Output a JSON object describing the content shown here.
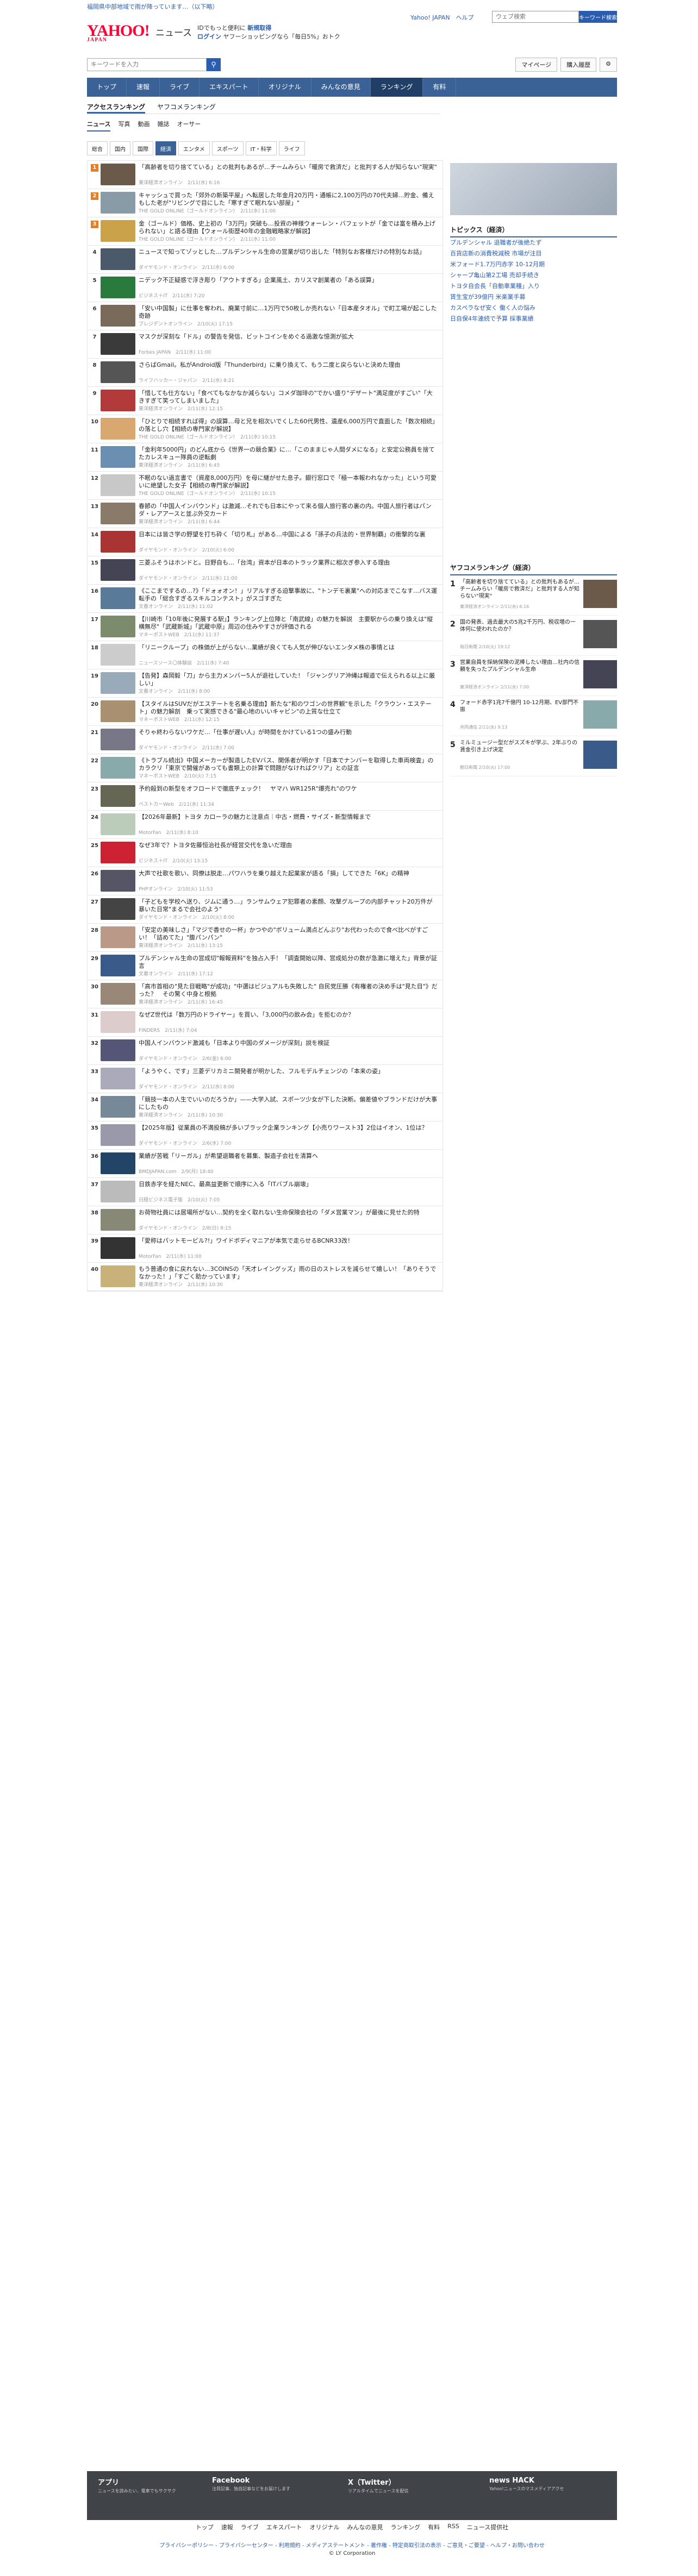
{
  "alert": "福岡県中部地域で雨が降っています…（以下略）",
  "header": {
    "logo": "YAHOO!",
    "logo_sub": "JAPAN",
    "service": "ニュース",
    "promo1": "IDでもっと便利に",
    "promo1_link": "新規取得",
    "promo2_login": "ログイン",
    "promo2": "ヤフーショッピングなら「毎日5%」おトク",
    "links": "Yahoo! JAPAN　ヘルプ",
    "search_placeholder": "ウェブ検索",
    "search_btn": "キーワード検索"
  },
  "search": {
    "placeholder": "キーワードを入力",
    "mypage": "マイページ",
    "purchase": "購入履歴"
  },
  "nav": [
    "トップ",
    "速報",
    "ライブ",
    "エキスパート",
    "オリジナル",
    "みんなの意見",
    "ランキング",
    "有料"
  ],
  "tabs1": [
    "アクセスランキング",
    "ヤフコメランキング"
  ],
  "tabs2": [
    "ニュース",
    "写真",
    "動画",
    "雑誌",
    "オーサー"
  ],
  "tabs3": [
    "総合",
    "国内",
    "国際",
    "経済",
    "エンタメ",
    "スポーツ",
    "IT・科学",
    "ライフ"
  ],
  "items": [
    {
      "rank": "1",
      "title": "「高齢者を切り捨てている」との批判もあるが…チームみらい「暖房で救済だ」と批判する人が知らない\"現実\"",
      "src": "東洋経済オンライン　2/11(水) 6:16"
    },
    {
      "rank": "2",
      "title": "キャッシュで買った「郊外の新築平屋」へ転居した年金月20万円・通帳に2,100万円の70代夫婦…貯金、備えもした老が\"リビングで目にした「寒すぎて眠れない部屋」\"",
      "src": "THE GOLD ONLINE（ゴールドオンライン）　2/11(水) 11:00"
    },
    {
      "rank": "3",
      "title": "金（ゴールド）価格、史上初の「3万円」突破も…投資の神様ウォーレン・バフェットが「金では富を積み上げられない」と語る理由【ウォール街歴40年の金融戦略家が解説】",
      "src": "THE GOLD ONLINE（ゴールドオンライン）　2/11(水) 11:00"
    },
    {
      "rank": "4",
      "title": "ニュースで知ってゾッとした…プルデンシャル生命の営業が切り出した「特別なお客様だけの特別なお話」",
      "src": "ダイヤモンド・オンライン　2/11(水) 6:00"
    },
    {
      "rank": "5",
      "title": "ニデック不正疑惑で浮き彫り「アウトすぎる」企業風土、カリスマ創業者の「ある誤算」",
      "src": "ビジネス＋IT　2/11(水) 7:20"
    },
    {
      "rank": "6",
      "title": "「安い中国製」に仕事を奪われ、廃業寸前に…1万円で50枚しか売れない「日本産タオル」で町工場が起こした奇跡",
      "src": "プレジデントオンライン　2/10(火) 17:15"
    },
    {
      "rank": "7",
      "title": "マスクが深刻な「ドル」の警告を発信、ビットコインをめぐる過激な憶測が拡大",
      "src": "Forbes JAPAN　2/11(水) 11:00"
    },
    {
      "rank": "8",
      "title": "さらばGmail。私がAndroid版「Thunderbird」に乗り換えて、もう二度と戻らないと決めた理由",
      "src": "ライフハッカー・ジャパン　2/11(水) 8:21"
    },
    {
      "rank": "9",
      "title": "「惜しても仕方ない」「食べてもなかなか減らない」コメダ珈琲の\"でかい盛り\"デザート\"満足度がすごい\"「大きすぎて笑ってしまいました」",
      "src": "東洋経済オンライン　2/11(水) 12:15"
    },
    {
      "rank": "10",
      "title": "「ひとりで相続すれば得」の誤算…母と兄を相次いでくした60代男性、遺産6,000万円で直面した「数次相続」の落とし穴【相続の専門家が解説】",
      "src": "THE GOLD ONLINE（ゴールドオンライン）　2/11(水) 10:15"
    },
    {
      "rank": "11",
      "title": "「金利年5000円」のどん底から《世界一の競合業》に…「このままじゃ人間ダメになる」と安定公務員を捨てたカレスキュー隊員の逆転劇",
      "src": "東洋経済オンライン　2/11(水) 6:45"
    },
    {
      "rank": "12",
      "title": "不眠のない過言書で（資産8,000万円）を母に継がせた息子。銀行窓口で「極一本報われなかった」という可愛いに絶望した女子【相続の専門家が解説】",
      "src": "THE GOLD ONLINE（ゴールドオンライン）　2/11(水) 10:15"
    },
    {
      "rank": "13",
      "title": "春節の「中国人インバウンド」は激減…それでも日本にやって来る個人旅行客の裏の内。中国人旅行者はパンダ・レアアースと並ぶ外交カード",
      "src": "東洋経済オンライン　2/11(水) 6:44"
    },
    {
      "rank": "14",
      "title": "日本には皆さ学の野望を打ち砕く「切り札」がある…中国による「孫子の兵法的・世界制覇」の衝撃的な裏",
      "src": "ダイヤモンド・オンライン　2/10(火) 6:00"
    },
    {
      "rank": "15",
      "title": "三菱ふそうはホンドと。日野自も…「台湾」資本が日本のトラック業界に相次ぎ参入する理由",
      "src": "ダイヤモンド・オンライン　2/11(水) 11:00"
    },
    {
      "rank": "16",
      "title": "《ここまでするの…?》「ドォォオン！」リアルすぎる迫撃事故に、\"トンデモ裏業\"への対応までこなす…バス運転手の「総合すぎるスキルコンテスト」がスゴすぎた",
      "src": "文春オンライン　2/11(水) 11:02"
    },
    {
      "rank": "17",
      "title": "【川崎市「10年後に発展する駅」】ランキング上位陣と「南武線」の魅力を解説　主要駅からの乗り換えは\"縦横無尽\"「武蔵新城」「武蔵中原」周辺の住みやすさが評価される",
      "src": "マネーポストWEB　2/11(水) 11:37"
    },
    {
      "rank": "18",
      "title": "「リニークループ」の株価が上がらない…業績が良くても人気が伸びないエンタメ株の事情とは",
      "src": "ニュースソース〇体験談　2/11(水) 7:40"
    },
    {
      "rank": "19",
      "title": "【告発】森岡毅「刀」から主力メンバー5人が退社していた！「ジャングリア沖縄は報道で伝えられる以上に厳しい」",
      "src": "文春オンライン　2/11(水) 8:00"
    },
    {
      "rank": "20",
      "title": "【スタイルはSUVだがエステートを名乗る理由】新たな\"和のワゴンの世界観\"を示した「クラウン・エステート」の魅力解剖　乗って実感できる\"最心地のいいキャビン\"の上質な仕立て",
      "src": "マネーポストWEB　2/11(水) 12:15"
    },
    {
      "rank": "21",
      "title": "そりゃ終わらないワケだ…「仕事が遅い人」が時間をかけている1つの盛み行動",
      "src": "ダイヤモンド・オンライン　2/11(水) 7:00"
    },
    {
      "rank": "22",
      "title": "《トラブル続出》中国メーカーが製造したEVバス、関係者が明かす「日本でナンバーを取得した車両検査」のカラクリ「東京で開催があっても書類上の計算で問題がなければクリア」との証言",
      "src": "マネーポストWEB　2/10(火) 7:15"
    },
    {
      "rank": "23",
      "title": "予約殺到の新型をオフロードで徹底チェック！　ヤマハ WR125R\"爆売れ\"のワケ",
      "src": "ベストカーWeb　2/11(水) 11:34"
    },
    {
      "rank": "24",
      "title": "【2026年最新】トヨタ カローラの魅力と注意点｜中古・燃費・サイズ・新型情報まで",
      "src": "MotorFan　2/11(水) 8:10"
    },
    {
      "rank": "25",
      "title": "なぜ3年で？トヨタ佐藤恒治社長が経営交代を急いだ理由",
      "src": "ビジネス＋IT　2/10(火) 13:15"
    },
    {
      "rank": "26",
      "title": "大声で社歌を歌い、同僚は脱走…パワハラを乗り越えた起業家が語る「損」してできた「6K」の精神",
      "src": "PHPオンライン　2/10(火) 11:53"
    },
    {
      "rank": "27",
      "title": "「子どもを学校へ送り、ジムに通う…」ランサムウェア犯罪者の素顔、攻撃グループの内部チャット20万件が暴いた日常\"まるで会社のよう\"",
      "src": "ダイヤモンド・オンライン　2/10(火) 8:00"
    },
    {
      "rank": "28",
      "title": "「安定の美味しさ」「マジで香せの一杯」かつやの\"ボリューム満点どんぶり\"お代わったので食べ比べがすごい！「詰めてた」\"腹パンパン\"",
      "src": "東洋経済オンライン　2/11(水) 13:15"
    },
    {
      "rank": "29",
      "title": "プルデンシャル生命の営成切\"報報資料\"を独占入手！「調査開始以降、営成処分の数が急激に増えた」背景が証言",
      "src": "文春オンライン　2/11(水) 17:12"
    },
    {
      "rank": "30",
      "title": "「高市首相の\"見た目戦略\"が成功」\"中選はビジュアルも失敗した\" 自民党圧勝《有権者の決め手は\"見た目\"》だった？　その驚く中身と根拠",
      "src": "東洋経済オンライン　2/11(水) 16:45"
    },
    {
      "rank": "31",
      "title": "なぜZ世代は「数万円のドライヤー」を買い、「3,000円の飲み会」を拒むのか？",
      "src": "FINDERS　2/11(水) 7:04"
    },
    {
      "rank": "32",
      "title": "中国人インバウンド激減も「日本より中国のダメージが深刻」説を検証",
      "src": "ダイヤモンド・オンライン　2/6(金) 6:00"
    },
    {
      "rank": "33",
      "title": "「ようやく、です」三菱デリカミニ開発者が明かした、フルモデルチェンジの「本来の姿」",
      "src": "ダイヤモンド・オンライン　2/11(水) 8:00"
    },
    {
      "rank": "34",
      "title": "「競技一本の人生でいいのだろうか」——大学入試、スポーツ少女が下した決断。偏差値やブランドだけが大事にしたもの",
      "src": "東洋経済オンライン　2/11(水) 10:30"
    },
    {
      "rank": "35",
      "title": "【2025年版】従業員の不満投稿が多いブラック企業ランキング【小売りワースト3】2位はイオン、1位は？",
      "src": "ダイヤモンド・オンライン　2/6(水) 7:00"
    },
    {
      "rank": "36",
      "title": "業績が苦戦「リーガル」が希望退職者を募集、製造子会社を清算へ",
      "src": "BMDJAPAN.com　2/9(月) 18:40"
    },
    {
      "rank": "37",
      "title": "日鉄赤字を経たNEC、最高益更新で順序に入る「ITバブル崩壊」",
      "src": "日経ビジネス電子版　2/10(火) 7:05"
    },
    {
      "rank": "38",
      "title": "お荷物社員には居場所がない…契約を全く取れない生命保険会社の「ダメ営業マン」が最後に見せた的特",
      "src": "ダイヤモンド・オンライン　2/8(日) 8:15"
    },
    {
      "rank": "39",
      "title": "「愛称はパットモービル?!」ワイドボディマニアが本気で走らせるBCNR33改！",
      "src": "MotorFan　2/11(水) 11:00"
    },
    {
      "rank": "40",
      "title": "もう普通の食に戻れない…3COINSの「天才レイングッズ」雨の日のストレスを減らせて嬉しい！「ありそうでなかった！」「すごく助かっています」",
      "src": "東洋経済オンライン　2/11(水) 10:30"
    }
  ],
  "topics": {
    "title": "トピックス（経済）",
    "items": [
      "プルデンシャル 退職者が後絶たず",
      "百貨店新の消費税減税 市場が注目",
      "米フォード1.7万円赤字 10-12月期",
      "シャープ亀山第2工場 売却手続き",
      "トヨタ自会長「自動車業種」入り",
      "賃生宝が39億円 米楽業手募",
      "カスペラなぜ安く 働く人の悩み",
      "日自保4年連続で予算 採事業績"
    ]
  },
  "ranking": {
    "title": "ヤフコメランキング（経済）",
    "items": [
      {
        "n": "1",
        "t": "「高齢者を切り捨てている」との批判もあるが…チームみらい「暖房で救済だ」と批判する人が知らない\"現実\"",
        "s": "東洋経済オンライン 2/11(水) 6:16"
      },
      {
        "n": "2",
        "t": "国の発表、過去最大の5兆2千万円、税収増の一体何に使われたのか？",
        "s": "毎日新聞 2/10(火) 19:12"
      },
      {
        "n": "3",
        "t": "営業自員を採納保険の泥棒したい理由…社内の信頼を失ったプルデンシャル生命",
        "s": "東洋経済オンライン 2/11(水) 7:00"
      },
      {
        "n": "4",
        "t": "フォード赤字1兆7千億円 10-12月期、EV部門不振",
        "s": "共同通信 2/11(水) 9:13"
      },
      {
        "n": "5",
        "t": "ミルミュージー型だがスズキが学ぶ、2年ぶりの賃金引き上げ決定",
        "s": "朝日新聞 2/10(火) 17:00"
      }
    ]
  },
  "footer": {
    "app": "アプリ",
    "app_sub": "ニュースを読みたい、電車でもサクサク",
    "fb": "Facebook",
    "fb_sub": "注目記事、独自記事などをお届けします",
    "x": "X（Twitter）",
    "x_sub": "リアルタイムでニュースを配信",
    "hack": "news HACK",
    "hack_sub": "Yahoo!ニュースのマスメディアアクセ",
    "links": [
      "トップ",
      "速報",
      "ライブ",
      "エキスパート",
      "オリジナル",
      "みんなの意見",
      "ランキング",
      "有料",
      "RSS",
      "ニュース提供社"
    ],
    "policy": "プライバシーポリシー - プライバシーセンター - 利用規約 - メディアステートメント - 著作権 - 特定商取引法の表示 - ご意見・ご要望 - ヘルプ・お問い合わせ",
    "copy": "© LY Corporation"
  }
}
